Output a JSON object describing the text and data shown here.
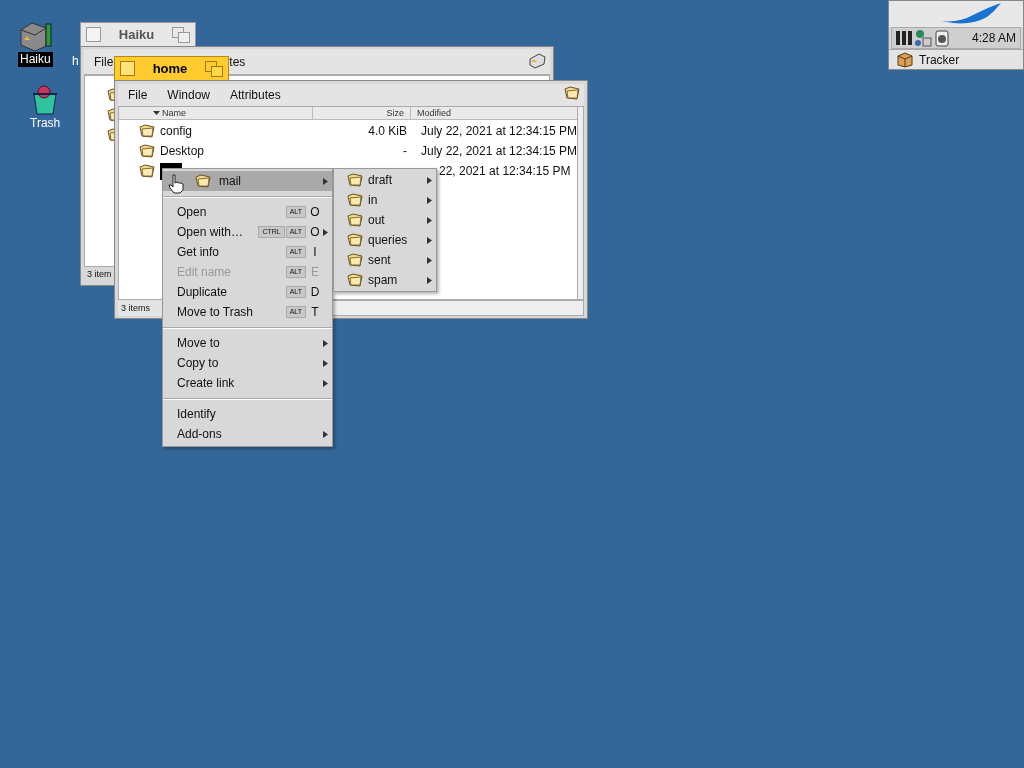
{
  "desktop_icons": [
    {
      "label": "Haiku",
      "kind": "disk",
      "selected": true
    },
    {
      "label": "Trash",
      "kind": "trash",
      "selected": false
    }
  ],
  "hidden_icon_label": "h",
  "back_window": {
    "title": "Haiku",
    "active": false,
    "menu": [
      "File",
      "tes"
    ],
    "status": "3 item"
  },
  "front_window": {
    "title": "home",
    "active": true,
    "menu": [
      "File",
      "Window",
      "Attributes"
    ],
    "columns": [
      {
        "label": "Name",
        "sorted": true
      },
      {
        "label": "Size",
        "sorted": false
      },
      {
        "label": "Modified",
        "sorted": false
      }
    ],
    "rows": [
      {
        "name": "config",
        "size": "4.0 KiB",
        "modified": "July 22, 2021 at 12:34:15 PM",
        "selected": false
      },
      {
        "name": "Desktop",
        "size": "-",
        "modified": "July 22, 2021 at 12:34:15 PM",
        "selected": false
      },
      {
        "modified": "22, 2021 at 12:34:15 PM",
        "selected": true
      }
    ],
    "status": "3 items"
  },
  "context_menu": {
    "items": [
      {
        "kind": "header",
        "label": "mail",
        "submenu": true,
        "highlighted": true
      },
      {
        "kind": "separator"
      },
      {
        "kind": "item",
        "label": "Open",
        "modifiers": [
          "ALT"
        ],
        "key": "O",
        "disabled": false
      },
      {
        "kind": "item",
        "label": "Open with…",
        "modifiers": [
          "CTRL",
          "ALT"
        ],
        "key": "O",
        "submenu": true,
        "disabled": false
      },
      {
        "kind": "item",
        "label": "Get info",
        "modifiers": [
          "ALT"
        ],
        "key": "I",
        "disabled": false
      },
      {
        "kind": "item",
        "label": "Edit name",
        "modifiers": [
          "ALT"
        ],
        "key": "E",
        "disabled": true
      },
      {
        "kind": "item",
        "label": "Duplicate",
        "modifiers": [
          "ALT"
        ],
        "key": "D",
        "disabled": false
      },
      {
        "kind": "item",
        "label": "Move to Trash",
        "modifiers": [
          "ALT"
        ],
        "key": "T",
        "disabled": false
      },
      {
        "kind": "separator"
      },
      {
        "kind": "item",
        "label": "Move to",
        "submenu": true,
        "disabled": false
      },
      {
        "kind": "item",
        "label": "Copy to",
        "submenu": true,
        "disabled": false
      },
      {
        "kind": "item",
        "label": "Create link",
        "submenu": true,
        "disabled": false
      },
      {
        "kind": "separator"
      },
      {
        "kind": "item",
        "label": "Identify",
        "disabled": false
      },
      {
        "kind": "item",
        "label": "Add-ons",
        "submenu": true,
        "disabled": false
      }
    ]
  },
  "submenu": {
    "items": [
      {
        "label": "draft"
      },
      {
        "label": "in"
      },
      {
        "label": "out"
      },
      {
        "label": "queries"
      },
      {
        "label": "sent"
      },
      {
        "label": "spam"
      }
    ]
  },
  "deskbar": {
    "time": "4:28 AM",
    "app": "Tracker"
  }
}
